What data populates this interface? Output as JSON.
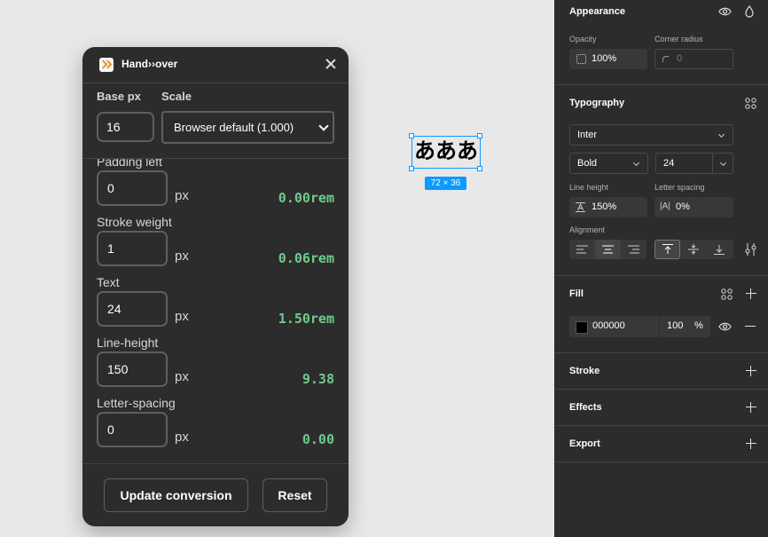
{
  "plugin": {
    "title": "Hand››over",
    "base_px_label": "Base px",
    "base_px_value": "16",
    "scale_label": "Scale",
    "scale_value": "Browser default (1.000)",
    "fields": [
      {
        "label": "Padding left",
        "value": "0",
        "unit": "px",
        "result": "0.00rem"
      },
      {
        "label": "Stroke weight",
        "value": "1",
        "unit": "px",
        "result": "0.06rem"
      },
      {
        "label": "Text",
        "value": "24",
        "unit": "px",
        "result": "1.50rem"
      },
      {
        "label": "Line-height",
        "value": "150",
        "unit": "px",
        "result": "9.38"
      },
      {
        "label": "Letter-spacing",
        "value": "0",
        "unit": "px",
        "result": "0.00"
      }
    ],
    "update_button": "Update conversion",
    "reset_button": "Reset"
  },
  "canvas": {
    "selected_text": "あああ",
    "size_badge": "72 × 36"
  },
  "properties": {
    "appearance": {
      "title": "Appearance",
      "opacity_label": "Opacity",
      "opacity_value": "100%",
      "corner_radius_label": "Corner radius",
      "corner_radius_value": "0"
    },
    "typography": {
      "title": "Typography",
      "font_family": "Inter",
      "font_weight": "Bold",
      "font_size": "24",
      "line_height_label": "Line height",
      "line_height_value": "150%",
      "letter_spacing_label": "Letter spacing",
      "letter_spacing_value": "0%",
      "alignment_label": "Alignment"
    },
    "fill": {
      "title": "Fill",
      "hex": "000000",
      "opacity": "100",
      "percent": "%",
      "swatch_color": "#000000"
    },
    "stroke": {
      "title": "Stroke"
    },
    "effects": {
      "title": "Effects"
    },
    "export": {
      "title": "Export"
    }
  },
  "colors": {
    "accent": "#0d99ff",
    "result_green": "#6fcb8a",
    "logo_orange": "#e8971a"
  }
}
